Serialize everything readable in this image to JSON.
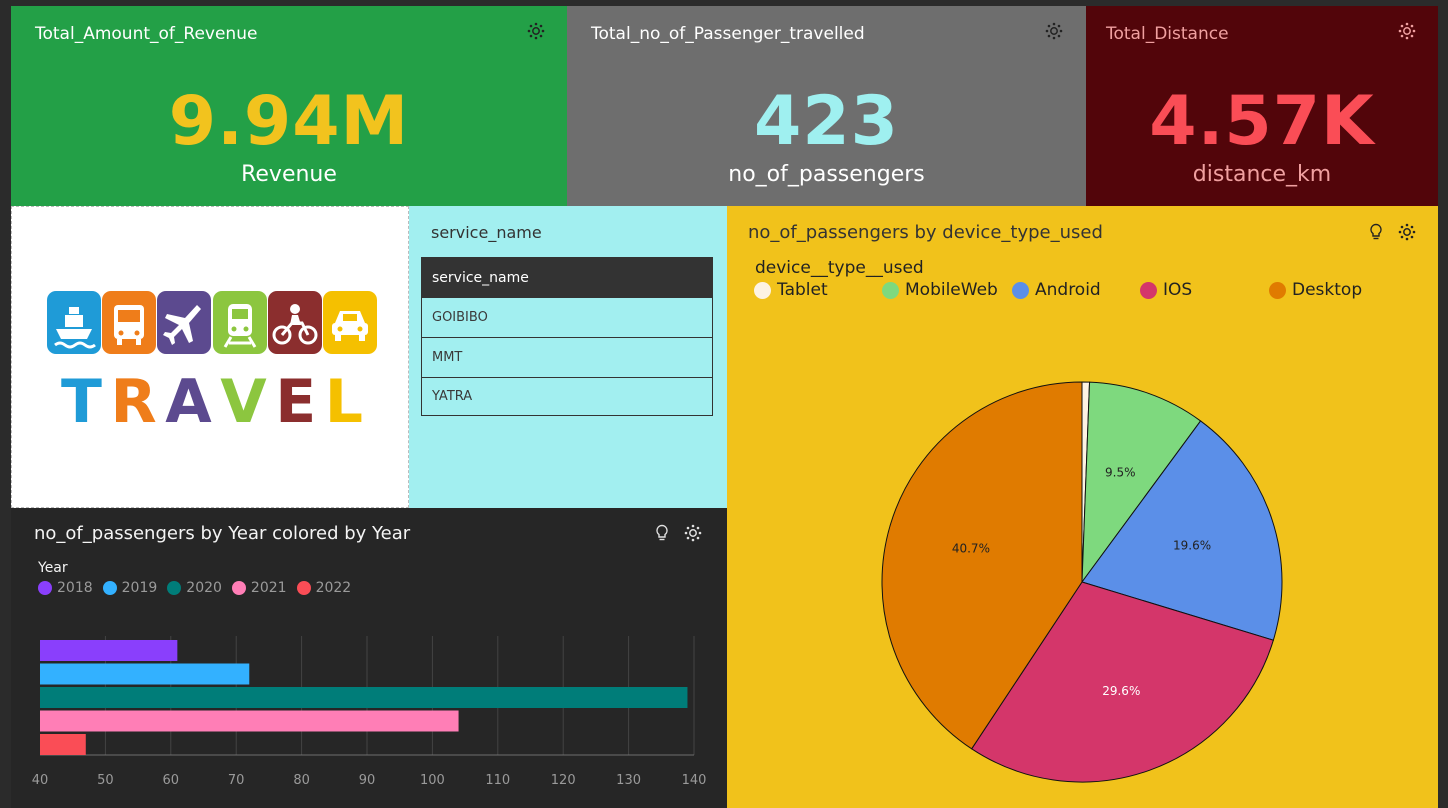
{
  "kpis": [
    {
      "title": "Total_Amount_of_Revenue",
      "value": "9.94M",
      "label": "Revenue",
      "bg": "#23a047",
      "title_color": "#ffffff",
      "value_color": "#f2c31e",
      "label_color": "#ffffff"
    },
    {
      "title": "Total_no_of_Passenger_travelled",
      "value": "423",
      "label": "no_of_passengers",
      "bg": "#6e6e6e",
      "title_color": "#ffffff",
      "value_color": "#9ff0f0",
      "label_color": "#ffffff"
    },
    {
      "title": "Total_Distance",
      "value": "4.57K",
      "label": "distance_km",
      "bg": "#52050a",
      "title_color": "#f0a0a0",
      "value_color": "#fa4d56",
      "label_color": "#f0a0a0"
    }
  ],
  "logo": {
    "text": "TRAVEL",
    "letter_colors": [
      "#1f9bd7",
      "#ef7d1a",
      "#5c4a8f",
      "#8cc63f",
      "#8b2e2e",
      "#f5c000"
    ],
    "tile_colors": [
      "#1f9bd7",
      "#ef7d1a",
      "#5c4a8f",
      "#8cc63f",
      "#8b2e2e",
      "#f5c000"
    ],
    "icons": [
      "ship-icon",
      "bus-icon",
      "plane-icon",
      "train-icon",
      "motorbike-icon",
      "car-icon"
    ]
  },
  "service_filter": {
    "title": "service_name",
    "header": "service_name",
    "rows": [
      "GOIBIBO",
      "MMT",
      "YATRA"
    ]
  },
  "bar_panel": {
    "title": "no_of_passengers by Year colored by Year",
    "legend_title": "Year"
  },
  "pie_panel": {
    "title": "no_of_passengers by device_type_used",
    "legend_title": "device__type__used"
  },
  "chart_data": [
    {
      "type": "bar",
      "orientation": "horizontal",
      "title": "no_of_passengers by Year colored by Year",
      "legend_title": "Year",
      "categories": [
        "2018",
        "2019",
        "2020",
        "2021",
        "2022"
      ],
      "values": [
        61,
        72,
        139,
        104,
        47
      ],
      "colors": [
        "#8a3ffc",
        "#33b1ff",
        "#007d79",
        "#ff7eb6",
        "#fa4d56"
      ],
      "xlim": [
        40,
        140
      ],
      "xticks": [
        "40",
        "50",
        "60",
        "70",
        "80",
        "90",
        "100",
        "110",
        "120",
        "130",
        "140"
      ],
      "grid": true,
      "legend_position": "top-left"
    },
    {
      "type": "pie",
      "title": "no_of_passengers by device_type_used",
      "legend_title": "device__type__used",
      "categories": [
        "Tablet",
        "MobileWeb",
        "Android",
        "IOS",
        "Desktop"
      ],
      "values": [
        0.6,
        9.5,
        19.6,
        29.6,
        40.7
      ],
      "labels": [
        "",
        "9.5%",
        "19.6%",
        "29.6%",
        "40.7%"
      ],
      "colors": [
        "#fdf3e3",
        "#7ed97e",
        "#5b8fe8",
        "#d4366a",
        "#e07b00"
      ],
      "legend_position": "top"
    }
  ]
}
